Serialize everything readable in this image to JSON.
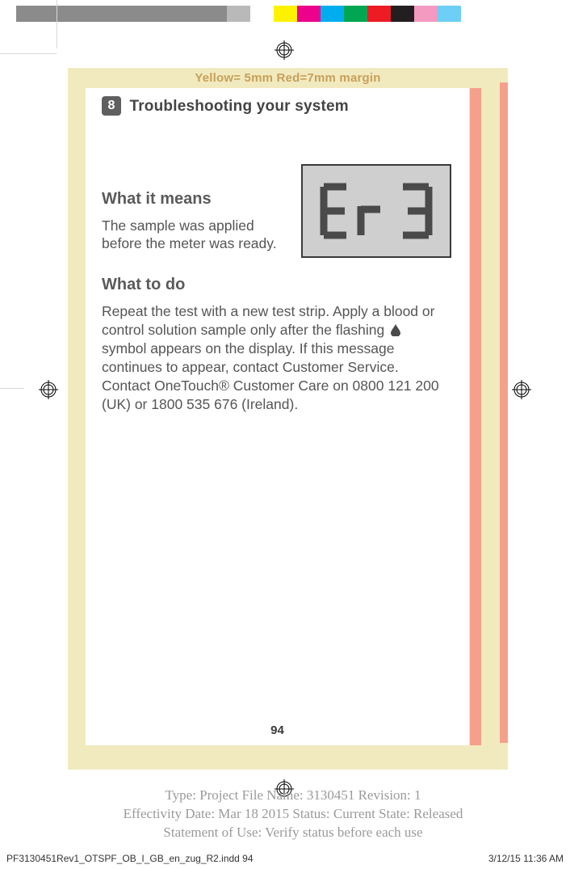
{
  "colorbar": [
    "#8b8b8b",
    "#8b8b8b",
    "#8b8b8b",
    "#8b8b8b",
    "#8b8b8b",
    "#8b8b8b",
    "#8b8b8b",
    "#8b8b8b",
    "#8b8b8b",
    "#b9b9b9",
    "#ffffff",
    "#fff200",
    "#ec008c",
    "#00aeef",
    "#00a651",
    "#ed1c24",
    "#231f20",
    "#f49ac1",
    "#6dcff6"
  ],
  "margin_label": "Yellow= 5mm  Red=7mm margin",
  "chapter": {
    "num": "8",
    "title": "Troubleshooting your system"
  },
  "section1": {
    "heading": "What it means",
    "body": "The sample was applied before the meter was ready."
  },
  "lcd_text": "Er 3",
  "section2": {
    "heading": "What to do",
    "body_pre": "Repeat the test with a new test strip. Apply a blood or control solution sample only after the flashing ",
    "body_post": " symbol appears on the display. If this message continues to appear, contact Customer Service. Contact OneTouch® Customer Care on 0800 121 200 (UK) or 1800 535 676 (Ireland)."
  },
  "page_number": "94",
  "doc_meta": {
    "line1": "Type: Project File  Name: 3130451  Revision: 1",
    "line2": "Effectivity Date: Mar 18 2015     Status: Current     State: Released",
    "line3": "Statement of Use: Verify status before each use"
  },
  "slug": {
    "file": "PF3130451Rev1_OTSPF_OB_I_GB_en_zug_R2.indd   94",
    "timestamp": "3/12/15   11:36 AM"
  }
}
